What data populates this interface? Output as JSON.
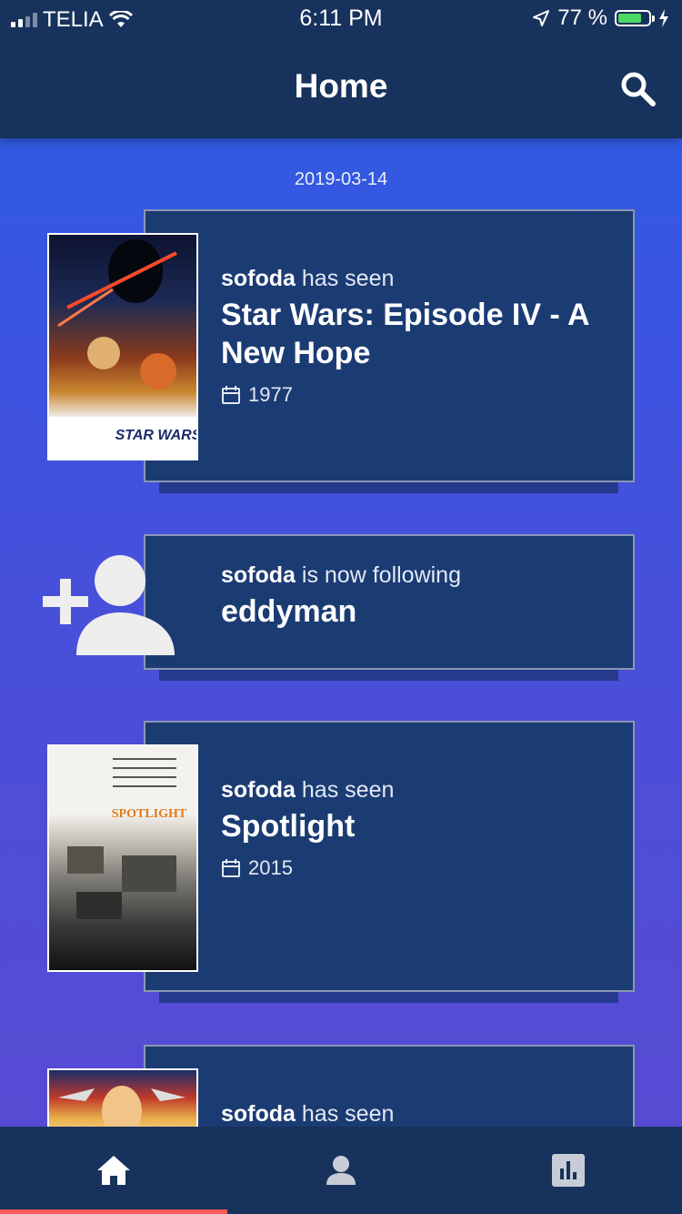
{
  "status_bar": {
    "carrier": "TELIA",
    "time": "6:11 PM",
    "battery_percent": "77 %",
    "battery_level": 0.77,
    "battery_color": "#4cd964"
  },
  "header": {
    "title": "Home",
    "search_icon": "search-icon"
  },
  "feed": {
    "date": "2019-03-14",
    "items": [
      {
        "user": "sofoda",
        "action": "has seen",
        "title": "Star Wars: Episode IV - A New Hope",
        "year": "1977",
        "poster_text": "STAR WARS"
      },
      {
        "user": "sofoda",
        "action": "is now following",
        "target": "eddyman",
        "icon": "add-user-icon"
      },
      {
        "user": "sofoda",
        "action": "has seen",
        "title": "Spotlight",
        "year": "2015",
        "poster_text": "SPOTLIGHT"
      },
      {
        "user": "sofoda",
        "action": "has seen"
      }
    ]
  },
  "tab_bar": {
    "tabs": [
      {
        "icon": "home-icon",
        "active": true
      },
      {
        "icon": "profile-icon",
        "active": false
      },
      {
        "icon": "stats-icon",
        "active": false
      }
    ],
    "active_color": "#ff5a5a"
  }
}
